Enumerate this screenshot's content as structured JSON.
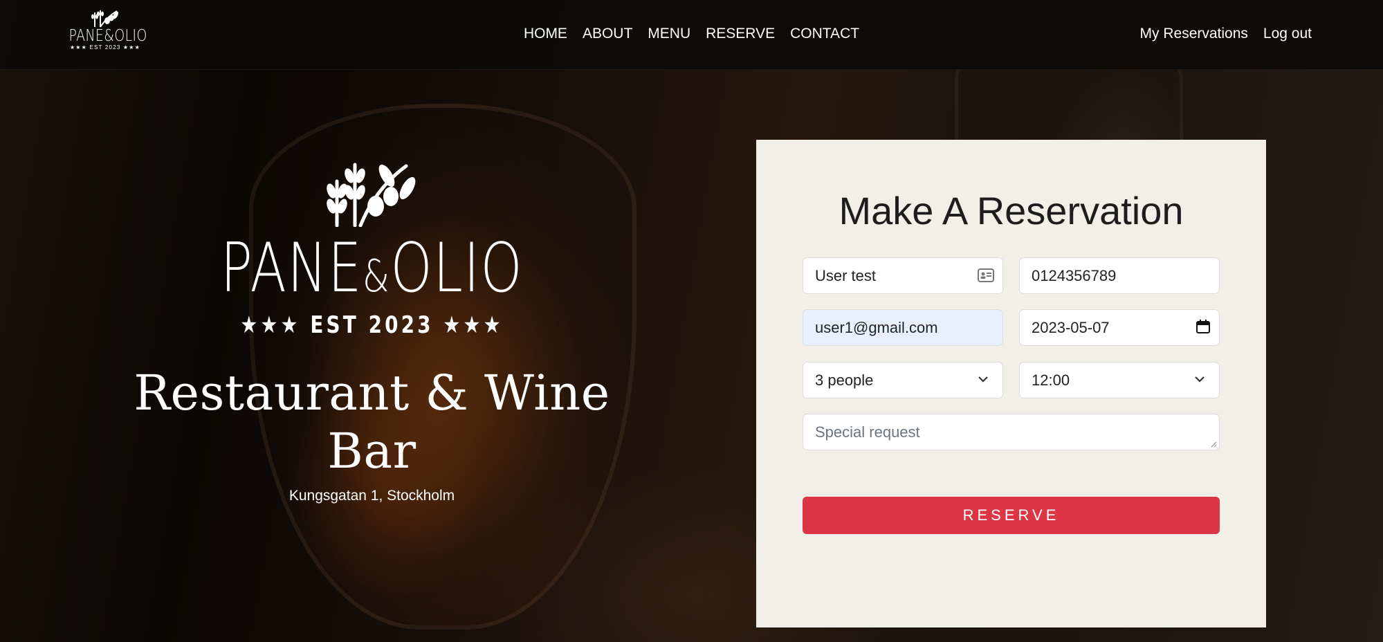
{
  "nav": {
    "logo_text": "PANE&OLIO",
    "logo_est": "★★★ EST 2023 ★★★",
    "links": [
      "HOME",
      "ABOUT",
      "MENU",
      "RESERVE",
      "CONTACT"
    ],
    "right_links": [
      "My Reservations",
      "Log out"
    ]
  },
  "hero": {
    "brand_left": "PANE",
    "brand_amp": "&",
    "brand_right": "OLIO",
    "est": "★★★ EST 2023 ★★★",
    "tagline": "Restaurant & Wine Bar",
    "address": "Kungsgatan 1, Stockholm"
  },
  "form": {
    "title": "Make A Reservation",
    "name_value": "User test",
    "phone_value": "0124356789",
    "email_value": "user1@gmail.com",
    "date_value": "2023-05-07",
    "people_value": "3 people",
    "time_value": "12:00",
    "special_request_placeholder": "Special request",
    "submit_label": "RESERVE"
  }
}
